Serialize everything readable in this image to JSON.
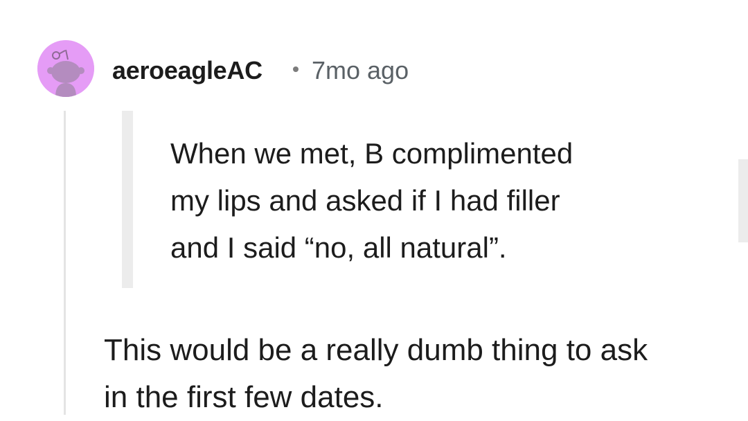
{
  "comment": {
    "username": "aeroeagleAC",
    "timestamp": "7mo ago",
    "avatar": {
      "icon": "snoo-avatar-icon",
      "background": "#e59cf6"
    },
    "quote_lines": [
      "When we met, B complimented",
      "my lips and asked if I had filler",
      "and I said “no, all natural”."
    ],
    "body_lines": [
      "This would be a really dumb thing to ask",
      "in the first few dates."
    ]
  }
}
